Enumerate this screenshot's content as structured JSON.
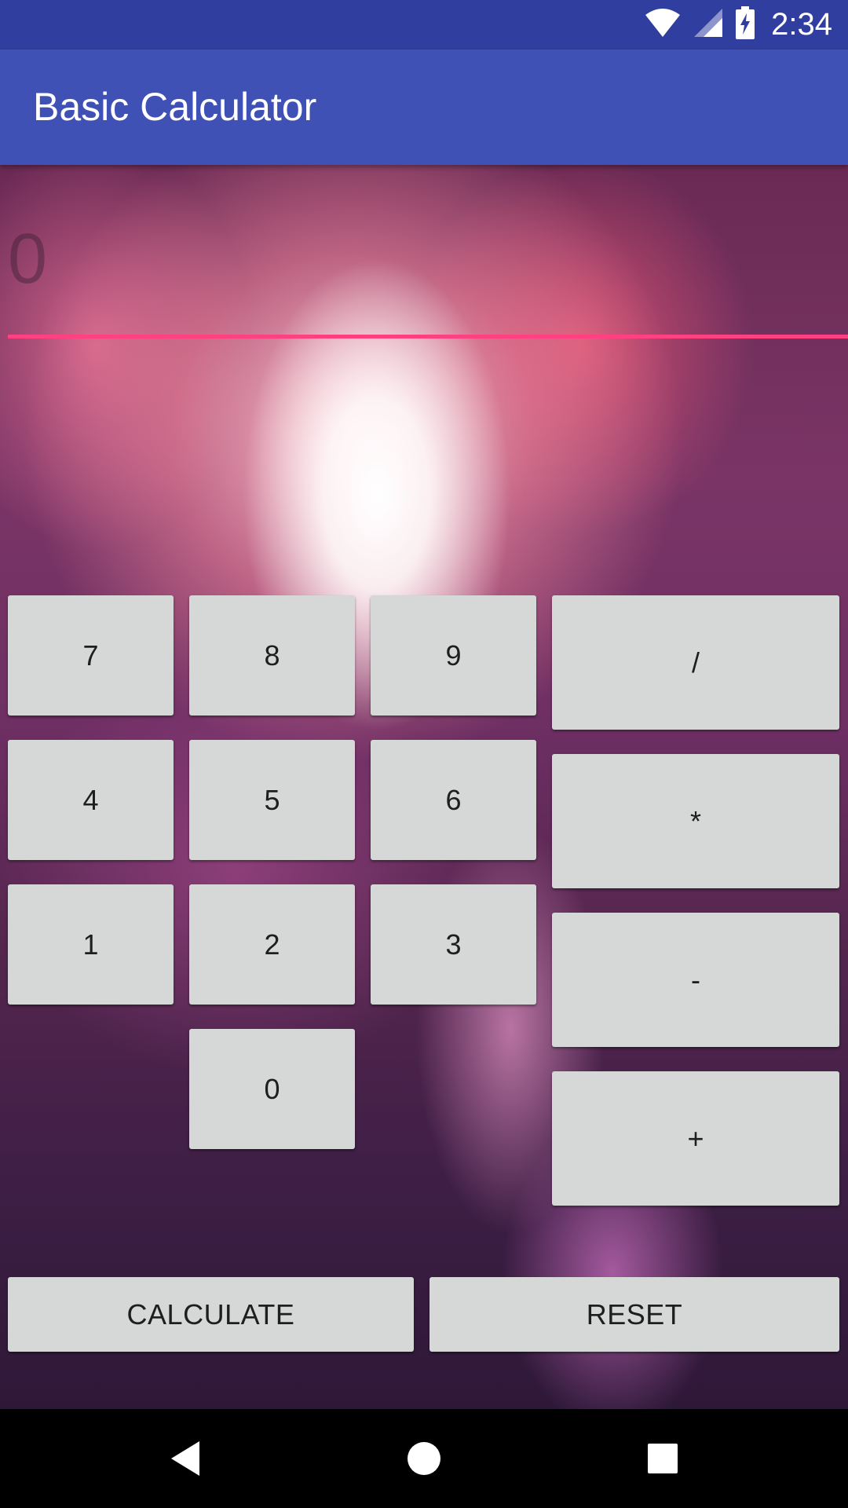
{
  "status_bar": {
    "time": "2:34",
    "icons": [
      "wifi-icon",
      "signal-icon",
      "battery-charging-icon"
    ]
  },
  "app_bar": {
    "title": "Basic Calculator"
  },
  "display": {
    "value": "0"
  },
  "keypad": {
    "digits": {
      "seven": "7",
      "eight": "8",
      "nine": "9",
      "four": "4",
      "five": "5",
      "six": "6",
      "one": "1",
      "two": "2",
      "three": "3",
      "zero": "0"
    },
    "operators": {
      "divide": "/",
      "multiply": "*",
      "subtract": "-",
      "add": "+"
    }
  },
  "actions": {
    "calculate": "CALCULATE",
    "reset": "RESET"
  },
  "nav_bar": {
    "icons": [
      "back-icon",
      "home-icon",
      "recents-icon"
    ]
  },
  "colors": {
    "status_bar": "#303f9f",
    "app_bar": "#3f51b5",
    "accent_underline": "#ff4081",
    "button_bg": "#d6d7d7"
  }
}
